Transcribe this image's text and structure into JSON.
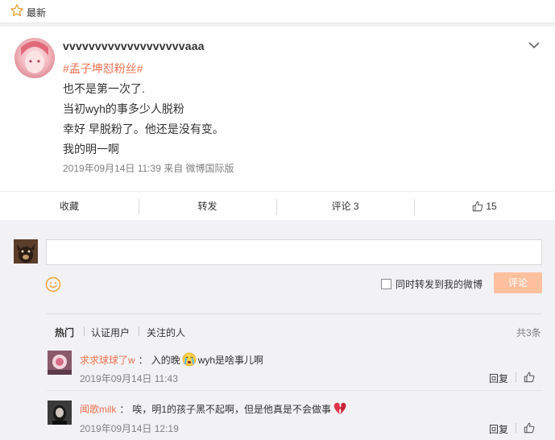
{
  "header": {
    "title": "最新"
  },
  "post": {
    "username": "vvvvvvvvvvvvvvvvvvvaaa",
    "topic": "#孟子坤怼粉丝#",
    "lines": [
      "也不是第一次了.",
      "当初wyh的事多少人脱粉",
      "幸好 早脱粉了。他还是没有变。",
      "我的明一啊"
    ],
    "time": "2019年09月14日 11:39",
    "source": "来自 微博国际版"
  },
  "actions": {
    "collect": "收藏",
    "forward": "转发",
    "comment": "评论 3",
    "like_count": "15"
  },
  "composer": {
    "input_value": "",
    "forward_label": "同时转发到我的微博",
    "submit_label": "评论"
  },
  "filters": {
    "hot": "热门",
    "verified": "认证用户",
    "following": "关注的人",
    "count": "共3条"
  },
  "comments": [
    {
      "name": "求求球球了w",
      "sep": "：",
      "before": "入的晚",
      "after": "wyh是啥事儿啊",
      "time": "2019年09月14日 11:43",
      "reply": "回复",
      "emoji": "crying-face"
    },
    {
      "name": "闻歌milk",
      "sep": "：",
      "before": "唉，明1的孩子黑不起啊，但是他真是不会做事",
      "after": "",
      "time": "2019年09月14日 12:19",
      "reply": "回复",
      "emoji": "broken-heart"
    }
  ]
}
